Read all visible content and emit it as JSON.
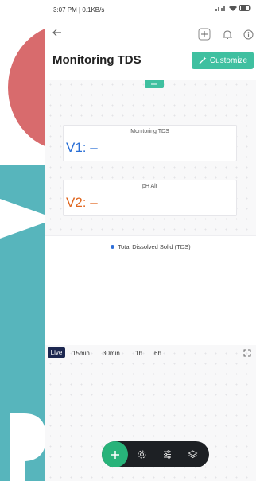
{
  "status_bar": {
    "time": "3:07 PM | 0.1KB/s"
  },
  "app_bar": {
    "title": "Monitoring TDS",
    "customize_label": "Customize"
  },
  "widgets": [
    {
      "title": "Monitoring TDS",
      "value": "V1: –",
      "color": "#2a6fd6"
    },
    {
      "title": "pH Air",
      "value": "V2: –",
      "color": "#e0661f"
    }
  ],
  "chart": {
    "legend": "Total Dissolved Solid (TDS)",
    "legend_color": "#2f6fd8"
  },
  "time_ranges": {
    "live": "Live",
    "items": [
      "15min",
      "30min",
      "1h",
      "6h"
    ]
  },
  "colors": {
    "accent": "#3fc0a0",
    "fab": "#28b37a",
    "toolbar": "#1d2024",
    "live_badge": "#1c2750"
  },
  "icons": {
    "back": "arrow-left-icon",
    "add": "plus-square-icon",
    "notifications": "bell-icon",
    "info": "info-circle-icon",
    "customize": "magic-wand-icon",
    "expand": "expand-icon",
    "settings": "gear-icon",
    "sliders": "sliders-icon",
    "layers": "layers-icon"
  }
}
